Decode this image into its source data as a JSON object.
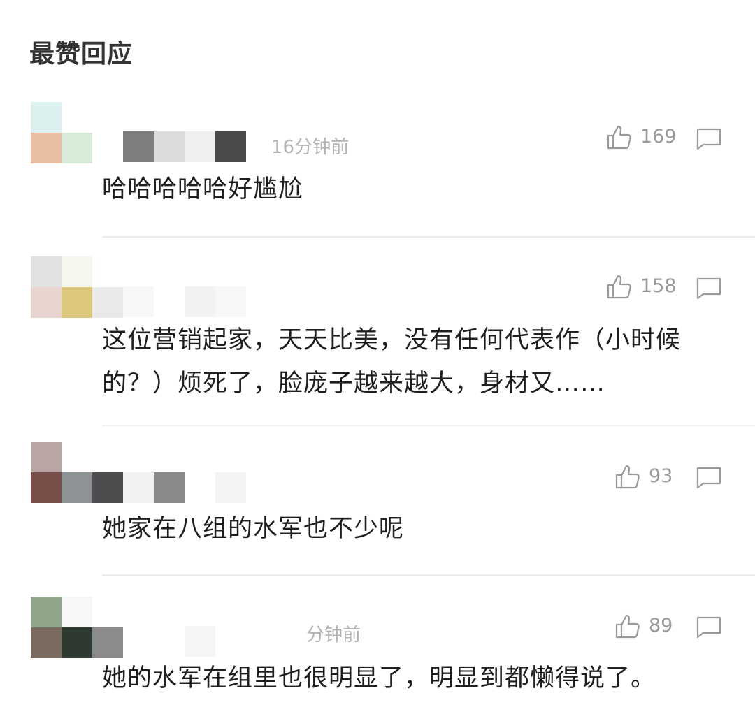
{
  "header": {
    "title": "最赞回应"
  },
  "comments": [
    {
      "time": "16分钟前",
      "likes": "169",
      "text": "哈哈哈哈哈好尴尬",
      "avatar_colors": [
        "#dcf0f0",
        "#ffffff",
        "#ffffff",
        "#e9bfa3",
        "#d7ebd8",
        "#ffffff"
      ],
      "name_colors": [
        "#7e7e7e",
        "#dcdcdc",
        "#f0f0f0",
        "#4a4a4a"
      ]
    },
    {
      "time": "",
      "likes": "158",
      "text": "这位营销起家，天天比美，没有任何代表作（小时候的？）烦死了，脸庞子越来越大，身材又……",
      "avatar_colors": [
        "#e2e2e2",
        "#f5f7ee",
        "#ffffff",
        "#e8d5cf",
        "#dcc77a",
        "#e9e9e9"
      ],
      "name_colors": [
        "#f7f7f7",
        "#ffffff",
        "#f2f2f2",
        "#f7f7f7"
      ]
    },
    {
      "time": "",
      "likes": "93",
      "text": "她家在八组的水军也不少呢",
      "avatar_colors": [
        "#b9a6a4",
        "#ffffff",
        "#ffffff",
        "#7a4e48",
        "#8d9294",
        "#4d4d4f"
      ],
      "name_colors": [
        "#f2f2f2",
        "#8a8a8a",
        "#ffffff",
        "#f3f3f3"
      ]
    },
    {
      "time": "分钟前",
      "likes": "89",
      "text": "她的水军在组里也很明显了，明显到都懒得说了。",
      "avatar_colors": [
        "#8fa58a",
        "#f7f7f7",
        "#ffffff",
        "#7b6a60",
        "#2e3a30",
        "#8b8b8b"
      ],
      "name_colors": [
        "#ffffff",
        "#ffffff",
        "#f5f5f5",
        "#ffffff"
      ]
    }
  ],
  "icons": {
    "like": "thumbs-up-icon",
    "reply": "comment-bubble-icon"
  }
}
